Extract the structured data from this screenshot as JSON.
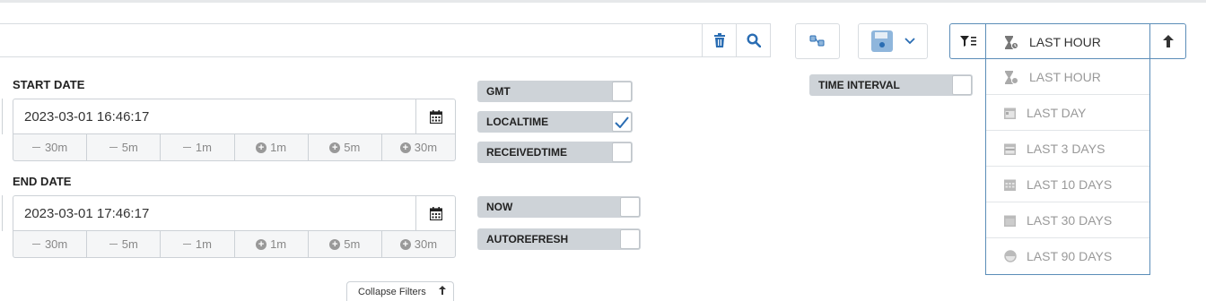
{
  "search": {
    "placeholder": ""
  },
  "start": {
    "label": "START DATE",
    "value": "2023-03-01 16:46:17",
    "steps": [
      "30m",
      "5m",
      "1m",
      "1m",
      "5m",
      "30m"
    ]
  },
  "end": {
    "label": "END DATE",
    "value": "2023-03-01 17:46:17",
    "steps": [
      "30m",
      "5m",
      "1m",
      "1m",
      "5m",
      "30m"
    ]
  },
  "toggles": {
    "gmt": "GMT",
    "localtime": "LOCALTIME",
    "receivedtime": "RECEIVEDTIME",
    "now": "NOW",
    "autorefresh": "AUTOREFRESH",
    "time_interval": "TIME INTERVAL"
  },
  "collapse_label": "Collapse Filters",
  "range": {
    "selected": "LAST HOUR",
    "options": [
      "LAST HOUR",
      "LAST DAY",
      "LAST 3 DAYS",
      "LAST 10 DAYS",
      "LAST 30 DAYS",
      "LAST 90 DAYS"
    ]
  },
  "colors": {
    "accent": "#2a6db3",
    "border_active": "#5b8db8",
    "toggle_bg": "#ced3d8"
  }
}
